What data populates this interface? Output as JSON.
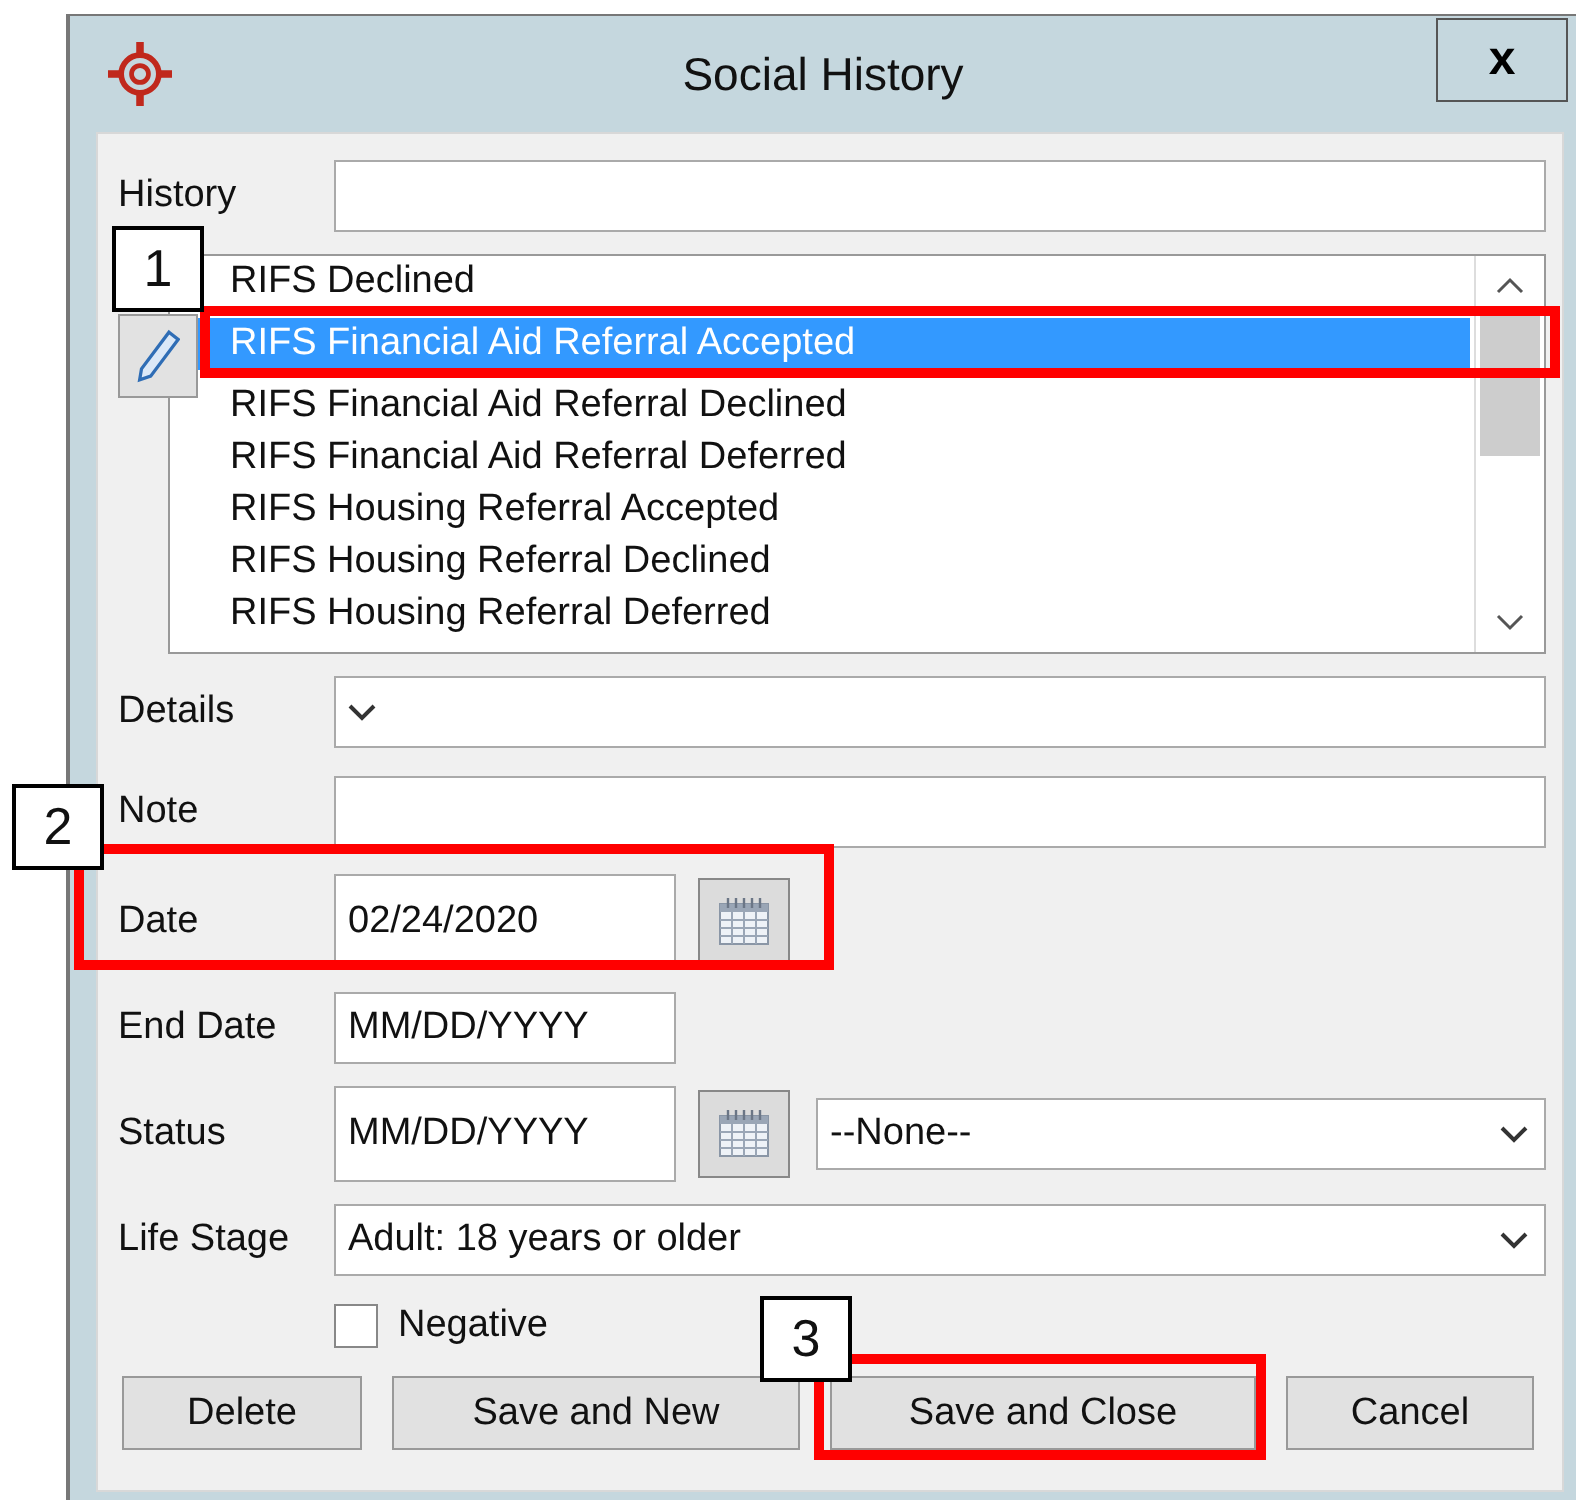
{
  "window": {
    "title": "Social History",
    "close": "x"
  },
  "history": {
    "label": "History"
  },
  "list": {
    "items": [
      {
        "text": "RIFS Declined",
        "selected": false
      },
      {
        "text": "RIFS Financial Aid Referral Accepted",
        "selected": true
      },
      {
        "text": "RIFS Financial Aid Referral Declined",
        "selected": false
      },
      {
        "text": "RIFS Financial Aid Referral Deferred",
        "selected": false
      },
      {
        "text": "RIFS Housing Referral Accepted",
        "selected": false
      },
      {
        "text": "RIFS Housing Referral Declined",
        "selected": false
      },
      {
        "text": "RIFS Housing Referral Deferred",
        "selected": false
      }
    ]
  },
  "fields": [
    {
      "kind": "combo",
      "label": "Details"
    },
    {
      "kind": "text",
      "label": "Note"
    },
    {
      "kind": "date",
      "label": "Date",
      "value": "02/24/2020"
    },
    {
      "kind": "short",
      "label": "End Date",
      "value": "MM/DD/YYYY"
    },
    {
      "kind": "status",
      "label": "Status",
      "value": "MM/DD/YYYY",
      "option": "--None--"
    },
    {
      "kind": "combo",
      "label": "Life Stage",
      "value": "Adult: 18 years or older"
    }
  ],
  "checkbox": {
    "label": "Negative",
    "checked": false
  },
  "buttons": [
    "Delete",
    "Save and New",
    "Save and Close",
    "Cancel"
  ],
  "callouts": [
    {
      "number": "1"
    },
    {
      "number": "2"
    },
    {
      "number": "3"
    }
  ]
}
